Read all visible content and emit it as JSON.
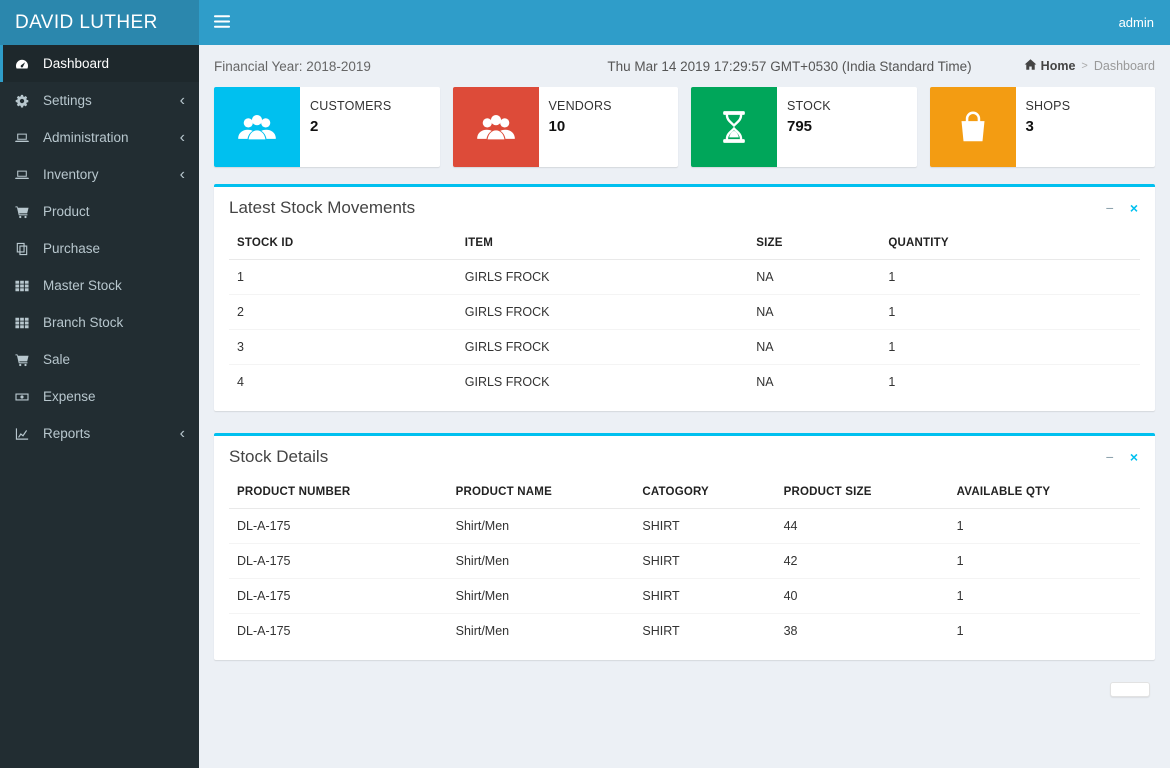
{
  "header": {
    "brand": "DAVID LUTHER",
    "user": "admin"
  },
  "sidebar": {
    "items": [
      {
        "label": "Dashboard",
        "icon": "dashboard-icon",
        "active": true,
        "chevron": false
      },
      {
        "label": "Settings",
        "icon": "gear-icon",
        "active": false,
        "chevron": true
      },
      {
        "label": "Administration",
        "icon": "laptop-icon",
        "active": false,
        "chevron": true
      },
      {
        "label": "Inventory",
        "icon": "laptop-icon",
        "active": false,
        "chevron": true
      },
      {
        "label": "Product",
        "icon": "cart-icon",
        "active": false,
        "chevron": false
      },
      {
        "label": "Purchase",
        "icon": "copy-icon",
        "active": false,
        "chevron": false
      },
      {
        "label": "Master Stock",
        "icon": "grid-icon",
        "active": false,
        "chevron": false
      },
      {
        "label": "Branch Stock",
        "icon": "grid-icon",
        "active": false,
        "chevron": false
      },
      {
        "label": "Sale",
        "icon": "cart-icon",
        "active": false,
        "chevron": false
      },
      {
        "label": "Expense",
        "icon": "money-icon",
        "active": false,
        "chevron": false
      },
      {
        "label": "Reports",
        "icon": "chart-icon",
        "active": false,
        "chevron": true
      }
    ]
  },
  "content_header": {
    "financial_year": "Financial Year: 2018-2019",
    "datetime": "Thu Mar 14 2019 17:29:57 GMT+0530 (India Standard Time)",
    "breadcrumb": {
      "home": "Home",
      "separator": ">",
      "current": "Dashboard"
    }
  },
  "infoboxes": [
    {
      "label": "CUSTOMERS",
      "value": "2",
      "color": "#00c0ef",
      "icon": "users-icon"
    },
    {
      "label": "VENDORS",
      "value": "10",
      "color": "#dd4b39",
      "icon": "users-icon"
    },
    {
      "label": "STOCK",
      "value": "795",
      "color": "#00a65a",
      "icon": "hourglass-icon"
    },
    {
      "label": "SHOPS",
      "value": "3",
      "color": "#f39c12",
      "icon": "bag-icon"
    }
  ],
  "panels": [
    {
      "title": "Latest Stock Movements",
      "columns": [
        "STOCK ID",
        "ITEM",
        "SIZE",
        "QUANTITY"
      ],
      "rows": [
        [
          "1",
          "GIRLS FROCK",
          "NA",
          "1"
        ],
        [
          "2",
          "GIRLS FROCK",
          "NA",
          "1"
        ],
        [
          "3",
          "GIRLS FROCK",
          "NA",
          "1"
        ],
        [
          "4",
          "GIRLS FROCK",
          "NA",
          "1"
        ]
      ],
      "tools": {
        "minimize": "−",
        "close": "×"
      }
    },
    {
      "title": "Stock Details",
      "columns": [
        "PRODUCT NUMBER",
        "PRODUCT NAME",
        "CATOGORY",
        "PRODUCT SIZE",
        "AVAILABLE QTY"
      ],
      "rows": [
        [
          "DL-A-175",
          "Shirt/Men",
          "SHIRT",
          "44",
          "1"
        ],
        [
          "DL-A-175",
          "Shirt/Men",
          "SHIRT",
          "42",
          "1"
        ],
        [
          "DL-A-175",
          "Shirt/Men",
          "SHIRT",
          "40",
          "1"
        ],
        [
          "DL-A-175",
          "Shirt/Men",
          "SHIRT",
          "38",
          "1"
        ]
      ],
      "tools": {
        "minimize": "−",
        "close": "×"
      }
    }
  ],
  "colors": {
    "header": "#2f9dc9",
    "brand": "#2b87ad",
    "sidebar": "#222d32",
    "panel_accent": "#00c0ef"
  }
}
